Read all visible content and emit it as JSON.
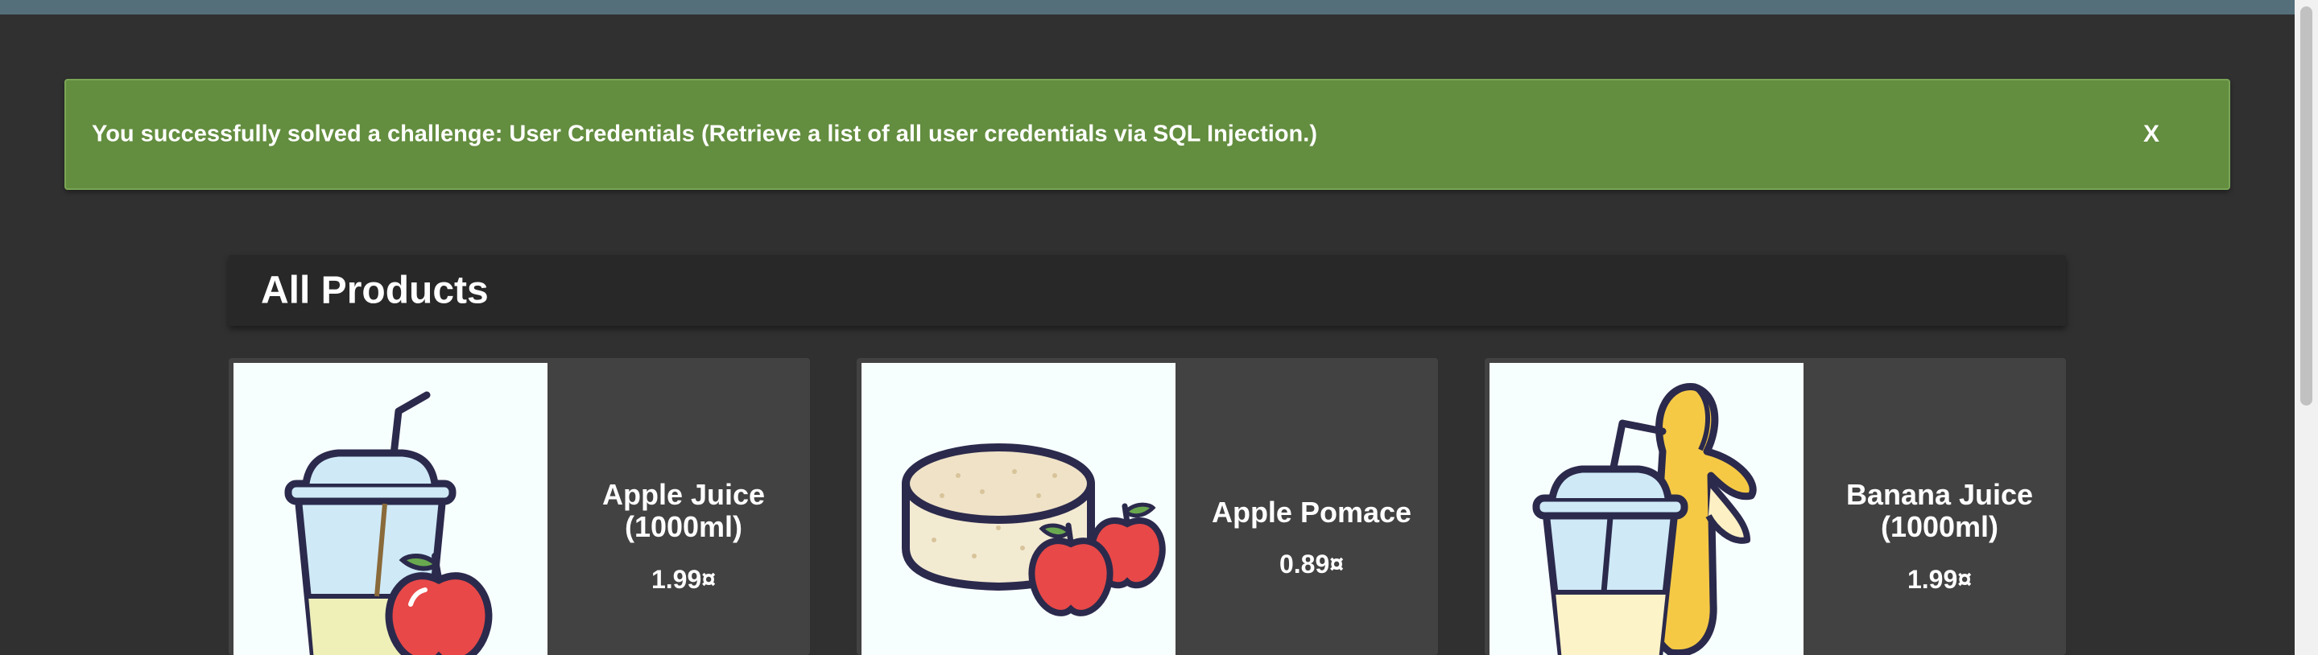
{
  "notification": {
    "message": "You successfully solved a challenge: User Credentials (Retrieve a list of all user credentials via SQL Injection.)",
    "close_label": "X",
    "color": "#638d3f"
  },
  "section": {
    "title": "All Products"
  },
  "products": [
    {
      "name": "Apple Juice (1000ml)",
      "price": "1.99¤",
      "image_icon": "apple-juice-icon"
    },
    {
      "name": "Apple Pomace",
      "price": "0.89¤",
      "image_icon": "apple-pomace-icon"
    },
    {
      "name": "Banana Juice (1000ml)",
      "price": "1.99¤",
      "image_icon": "banana-juice-icon"
    }
  ],
  "colors": {
    "toolbar": "#546e7a",
    "background": "#303030",
    "card": "#424242"
  }
}
